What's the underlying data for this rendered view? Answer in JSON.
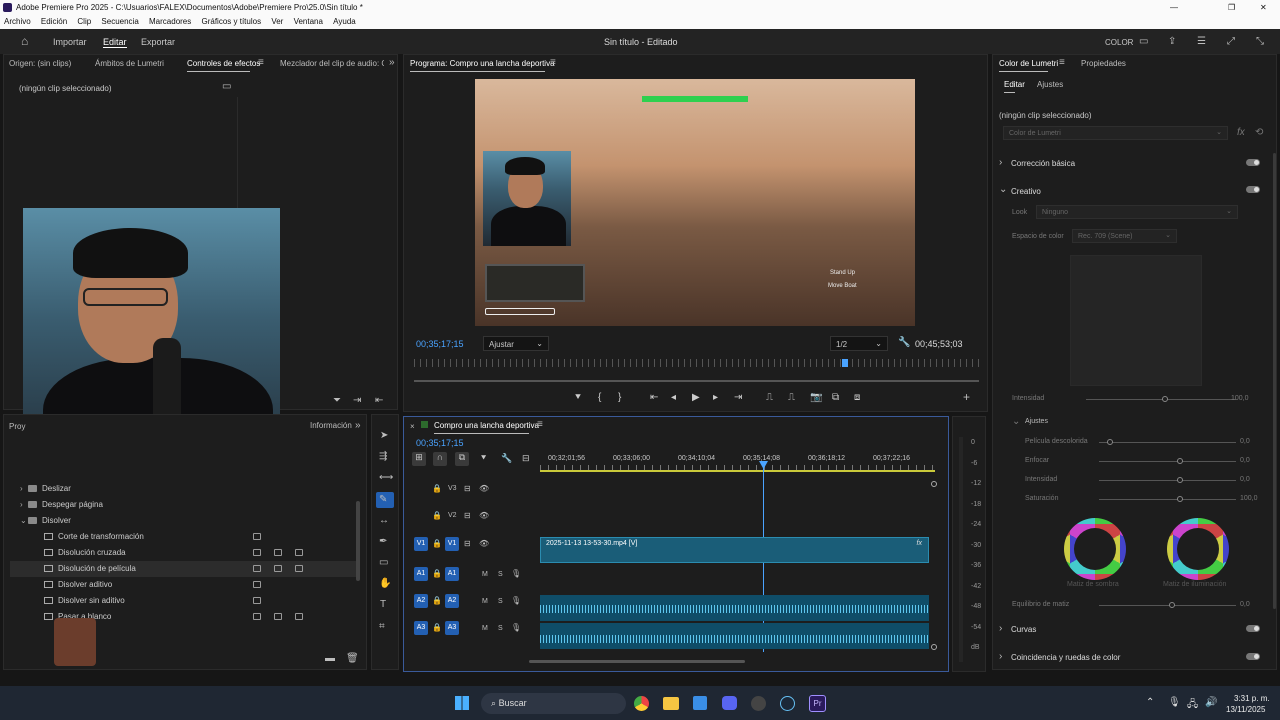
{
  "window": {
    "title": "Adobe Premiere Pro 2025 - C:\\Usuarios\\FALEX\\Documentos\\Adobe\\Premiere Pro\\25.0\\Sin título *"
  },
  "menu": [
    "Archivo",
    "Edición",
    "Clip",
    "Secuencia",
    "Marcadores",
    "Gráficos y títulos",
    "Ver",
    "Ventana",
    "Ayuda"
  ],
  "workspace": {
    "tabs": [
      "Importar",
      "Editar",
      "Exportar"
    ],
    "active": "Editar",
    "project_title": "Sin título - Editado",
    "color_label": "COLOR"
  },
  "left_panel": {
    "tabs": [
      "Origen: (sin clips)",
      "Ámbitos de Lumetri",
      "Controles de efectos",
      "Mezclador del clip de audio: Con"
    ],
    "active": "Controles de efectos",
    "empty_text": "(ningún clip seleccionado)"
  },
  "program": {
    "title": "Programa: Compro una lancha deportiva",
    "timecode": "00;35;17;15",
    "fit": "Ajustar",
    "resolution": "1/2",
    "duration": "00;45;53;03",
    "hud_lines": [
      "Stand Up",
      "Move Boat"
    ]
  },
  "project": {
    "tabs": [
      "Proy",
      "Información"
    ],
    "tree": [
      {
        "label": "Deslizar",
        "type": "folder",
        "expanded": false
      },
      {
        "label": "Despegar página",
        "type": "folder",
        "expanded": false
      },
      {
        "label": "Disolver",
        "type": "folder",
        "expanded": true
      },
      {
        "label": "Corte de transformación",
        "type": "effect"
      },
      {
        "label": "Disolución cruzada",
        "type": "effect"
      },
      {
        "label": "Disolución de película",
        "type": "effect",
        "selected": true
      },
      {
        "label": "Disolver aditivo",
        "type": "effect"
      },
      {
        "label": "Disolver sin aditivo",
        "type": "effect"
      },
      {
        "label": "Pasar a blanco",
        "type": "effect"
      }
    ]
  },
  "timeline": {
    "title": "Compro una lancha deportiva",
    "timecode": "00;35;17;15",
    "ruler": [
      "00;32;01;56",
      "00;33;06;00",
      "00;34;10;04",
      "00;35;14;08",
      "00;36;18;12",
      "00;37;22;16"
    ],
    "tracks": [
      {
        "name": "V3"
      },
      {
        "name": "V2"
      },
      {
        "name": "V1",
        "src": "V1"
      },
      {
        "name": "A1",
        "src": "A1"
      },
      {
        "name": "A2",
        "src": "A2"
      },
      {
        "name": "A3",
        "src": "A3"
      }
    ],
    "clip_label": "2025-11-13 13-53-30.mp4 [V]",
    "fx_label": "fx"
  },
  "meter": {
    "labels": [
      "0",
      "-6",
      "-12",
      "-18",
      "-24",
      "-30",
      "-36",
      "-42",
      "-48",
      "-54",
      "dB"
    ]
  },
  "lumetri": {
    "tabs": [
      "Color de Lumetri",
      "Propiedades"
    ],
    "subtabs": [
      "Editar",
      "Ajustes"
    ],
    "empty_text": "(ningún clip seleccionado)",
    "preset": "Color de Lumetri",
    "sections": [
      "Corrección básica",
      "Creativo",
      "Curvas",
      "Coincidencia y ruedas de color"
    ],
    "look_label": "Look",
    "look_value": "Ninguno",
    "space_label": "Espacio de color",
    "space_value": "Rec. 709 (Scene)",
    "intensity_label": "Intensidad",
    "intensity_value": "100,0",
    "adjust_label": "Ajustes",
    "adjust": [
      {
        "label": "Película descolorida",
        "value": "0,0"
      },
      {
        "label": "Enfocar",
        "value": "0,0"
      },
      {
        "label": "Intensidad",
        "value": "0,0"
      },
      {
        "label": "Saturación",
        "value": "100,0"
      }
    ],
    "wheels": [
      "Matiz de sombra",
      "Matiz de iluminación"
    ],
    "balance_label": "Equilibrio de matiz",
    "balance_value": "0,0"
  },
  "taskbar": {
    "search": "Buscar",
    "time": "3:31 p. m.",
    "date": "13/11/2025"
  }
}
